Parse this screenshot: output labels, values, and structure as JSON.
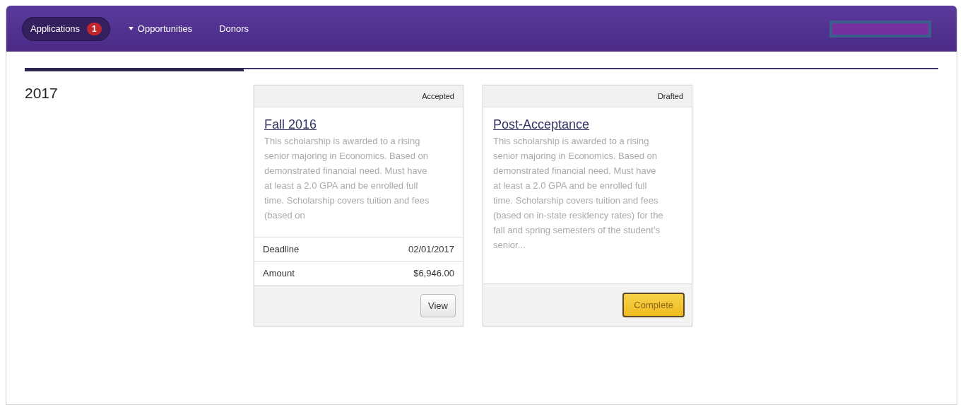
{
  "nav": {
    "items": [
      {
        "label": "Applications",
        "selected": true,
        "badge": "1",
        "dropdown": false
      },
      {
        "label": "Opportunities",
        "selected": false,
        "dropdown": true
      },
      {
        "label": "Donors",
        "selected": false,
        "dropdown": false
      }
    ]
  },
  "progress": {
    "level": 0.24
  },
  "year": "2017",
  "cards": [
    {
      "status": "Accepted",
      "title": "Fall 2016",
      "description": "This scholarship is awarded to a rising senior majoring in Economics. Based on demonstrated financial need. Must have at least a 2.0 GPA and be enrolled full time. Scholarship covers tuition and fees (based on",
      "details": [
        {
          "label": "Deadline",
          "value": "02/01/2017"
        },
        {
          "label": "Amount",
          "value": "$6,946.00"
        }
      ],
      "button": {
        "label": "View",
        "kind": "default"
      }
    },
    {
      "status": "Drafted",
      "title": "Post-Acceptance",
      "description": "This scholarship is awarded to a rising senior majoring in Economics. Based on demonstrated financial need. Must have at least a 2.0 GPA and be enrolled full time. Scholarship covers tuition and fees (based on in-state residency rates) for the fall and spring semesters of the student’s senior...",
      "button": {
        "label": "Complete",
        "kind": "primary"
      }
    }
  ]
}
